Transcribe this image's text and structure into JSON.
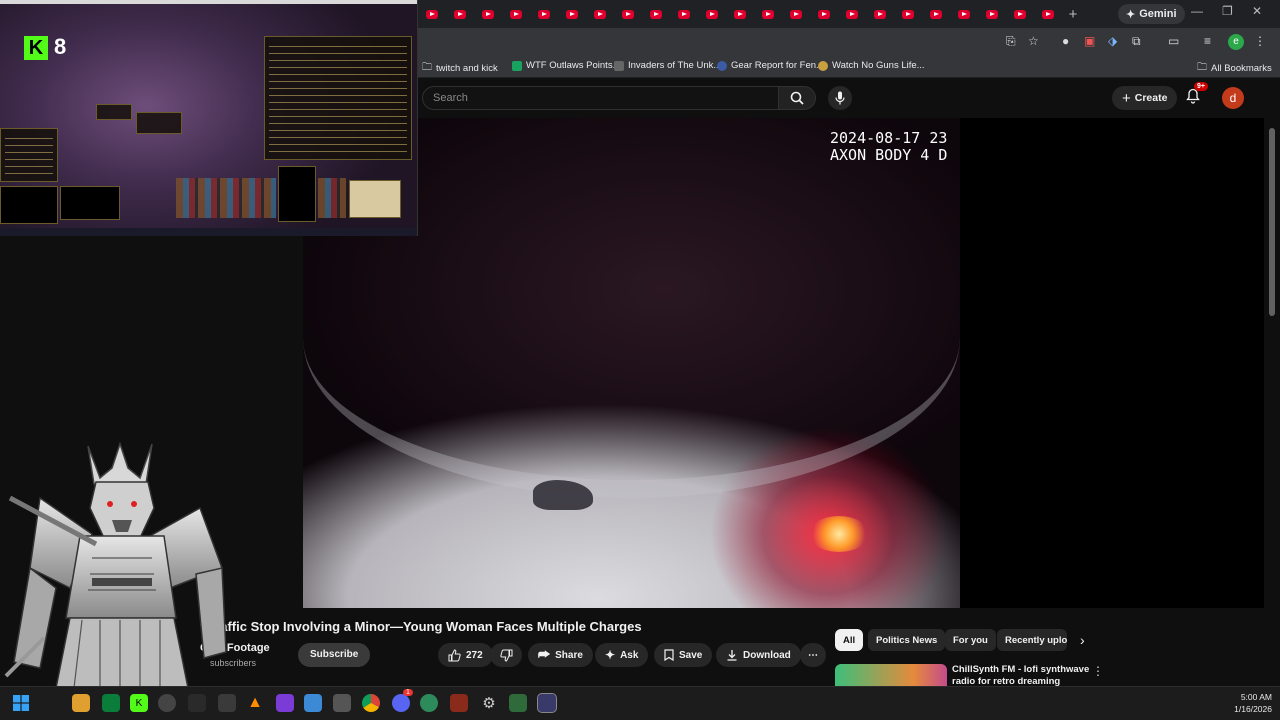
{
  "browser": {
    "tab_count": 23,
    "gemini_label": "Gemini",
    "bookmarks": [
      {
        "label": "twitch and kick",
        "color": "#9aa0a6"
      },
      {
        "label": "WTF Outlaws Points...",
        "color": "#1aa260"
      },
      {
        "label": "Invaders of The Unk...",
        "color": "#666666"
      },
      {
        "label": "Gear Report for Fen...",
        "color": "#3b5ba5"
      },
      {
        "label": "Watch No Guns Life...",
        "color": "#c8a040"
      }
    ],
    "all_bookmarks_label": "All Bookmarks",
    "profile_initial": "e"
  },
  "youtube": {
    "search_placeholder": "Search",
    "create_label": "Create",
    "notifications_badge": "9+",
    "avatar_initial": "d",
    "video": {
      "overlay_timestamp": "2024-08-17 23\nAXON BODY 4 D",
      "title": "t Traffic Stop Involving a Minor—Young Woman Faces Multiple Charges",
      "channel": "Cam Footage",
      "subscribers": "subscribers",
      "subscribe_label": "Subscribe",
      "likes": "272",
      "share_label": "Share",
      "ask_label": "Ask",
      "save_label": "Save",
      "download_label": "Download"
    },
    "chips": [
      "All",
      "Politics News",
      "For you",
      "Recently uplo"
    ],
    "recommendation": {
      "title": "ChillSynth FM - lofi synthwave radio for retro dreaming"
    }
  },
  "stream_overlay": {
    "kick_logo": "K",
    "viewer_count": "8"
  },
  "taskbar": {
    "time": "5:00 AM",
    "date": "1/16/2026",
    "discord_badge": "1"
  }
}
